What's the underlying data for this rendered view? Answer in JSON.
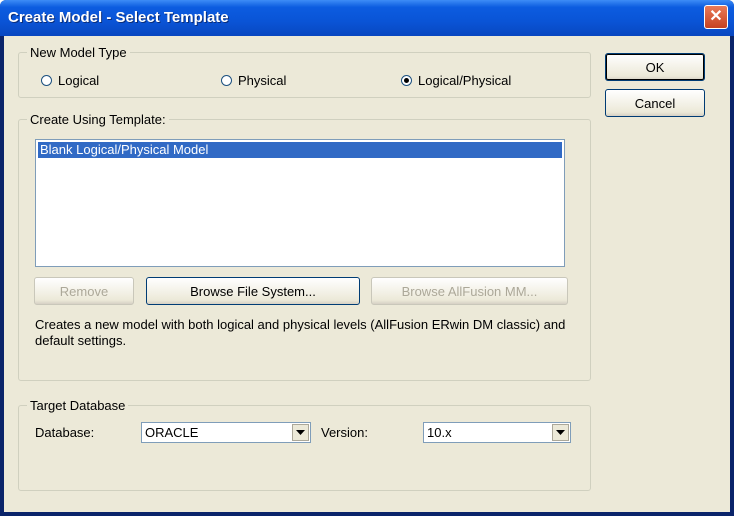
{
  "window": {
    "title": "Create Model - Select Template"
  },
  "buttons": {
    "ok": "OK",
    "cancel": "Cancel"
  },
  "model_type": {
    "legend": "New Model Type",
    "options": [
      {
        "label": "Logical",
        "selected": false
      },
      {
        "label": "Physical",
        "selected": false
      },
      {
        "label": "Logical/Physical",
        "selected": true
      }
    ]
  },
  "template": {
    "legend": "Create Using Template:",
    "items": [
      "Blank Logical/Physical Model"
    ],
    "selected_index": 0,
    "remove_label": "Remove",
    "browse_fs_label": "Browse File System...",
    "browse_mm_label": "Browse AllFusion MM...",
    "description": "Creates a new model with both logical and physical levels (AllFusion ERwin DM classic) and default settings."
  },
  "target": {
    "legend": "Target Database",
    "database_label": "Database:",
    "database_value": "ORACLE",
    "version_label": "Version:",
    "version_value": "10.x"
  },
  "colors": {
    "title_bar": "#0a54d6",
    "selection": "#316ac5",
    "dialog_bg": "#ece9d8"
  }
}
